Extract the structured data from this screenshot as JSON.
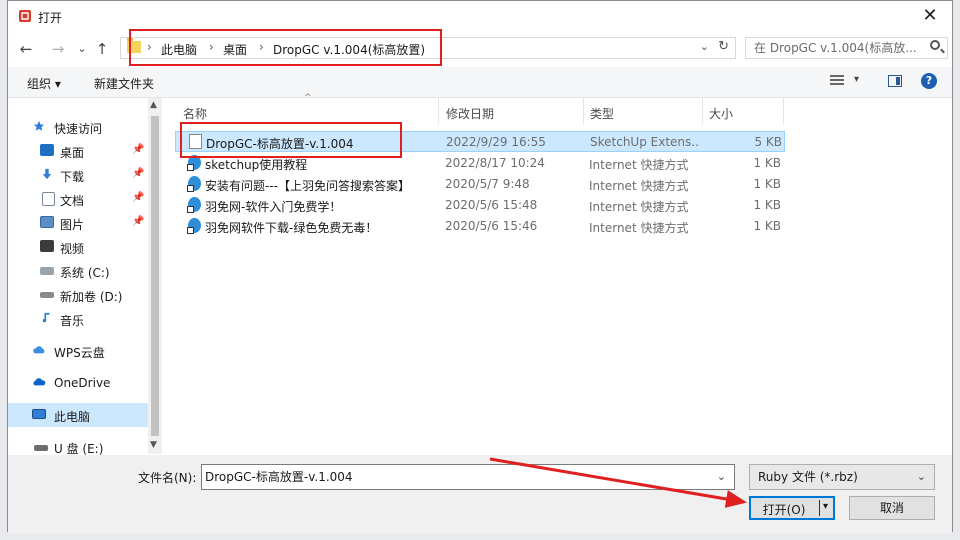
{
  "window": {
    "title": "打开",
    "close": "✕"
  },
  "nav": {
    "back": "←",
    "forward": "→",
    "recent": "⌄",
    "up": "↑"
  },
  "address": {
    "crumbs": [
      "此电脑",
      "桌面",
      "DropGC v.1.004(标高放置)"
    ],
    "separator": "›",
    "chevron": "⌄",
    "refresh": "↻"
  },
  "search": {
    "placeholder": "在 DropGC v.1.004(标高放..."
  },
  "toolbar": {
    "organize": "组织 ▾",
    "new_folder": "新建文件夹",
    "view_chevron": "▾",
    "help": "?"
  },
  "sidebar": {
    "items": [
      {
        "label": "快速访问",
        "icon": "star-icon"
      },
      {
        "label": "桌面",
        "icon": "desktop-icon",
        "pinned": true
      },
      {
        "label": "下载",
        "icon": "download-icon",
        "pinned": true
      },
      {
        "label": "文档",
        "icon": "documents-icon",
        "pinned": true
      },
      {
        "label": "图片",
        "icon": "pictures-icon",
        "pinned": true
      },
      {
        "label": "视频",
        "icon": "videos-icon"
      },
      {
        "label": "系统 (C:)",
        "icon": "drive-icon"
      },
      {
        "label": "新加卷 (D:)",
        "icon": "drive-icon"
      },
      {
        "label": "音乐",
        "icon": "music-icon"
      },
      {
        "label": "WPS云盘",
        "icon": "cloud-icon"
      },
      {
        "label": "OneDrive",
        "icon": "onedrive-icon"
      },
      {
        "label": "此电脑",
        "icon": "computer-icon",
        "selected": true
      },
      {
        "label": "U 盘 (E:)",
        "icon": "usb-drive-icon"
      }
    ],
    "pin_glyph": "📌"
  },
  "columns": {
    "name": "名称",
    "modified": "修改日期",
    "type": "类型",
    "size": "大小",
    "sort_indicator": "^"
  },
  "files": [
    {
      "name": "DropGC-标高放置-v.1.004",
      "modified": "2022/9/29 16:55",
      "type": "SketchUp Extens...",
      "size": "5 KB",
      "icon": "document-icon",
      "selected": true
    },
    {
      "name": "sketchup使用教程",
      "modified": "2022/8/17 10:24",
      "type": "Internet 快捷方式",
      "size": "1 KB",
      "icon": "internet-shortcut-icon"
    },
    {
      "name": "安装有问题---【上羽免问答搜索答案】",
      "modified": "2020/5/7 9:48",
      "type": "Internet 快捷方式",
      "size": "1 KB",
      "icon": "internet-shortcut-icon"
    },
    {
      "name": "羽免网-软件入门免费学！",
      "modified": "2020/5/6 15:48",
      "type": "Internet 快捷方式",
      "size": "1 KB",
      "icon": "internet-shortcut-icon"
    },
    {
      "name": "羽免网软件下载-绿色免费无毒！",
      "modified": "2020/5/6 15:46",
      "type": "Internet 快捷方式",
      "size": "1 KB",
      "icon": "internet-shortcut-icon"
    }
  ],
  "footer": {
    "filename_label": "文件名(N):",
    "filename_value": "DropGC-标高放置-v.1.004",
    "filetype_value": "Ruby 文件 (*.rbz)",
    "open_label": "打开(O)",
    "open_arrow": "▾",
    "cancel_label": "取消",
    "chevron": "⌄"
  },
  "colors": {
    "accent": "#0078d7",
    "highlight": "#e02020",
    "selection": "#cce8ff"
  }
}
